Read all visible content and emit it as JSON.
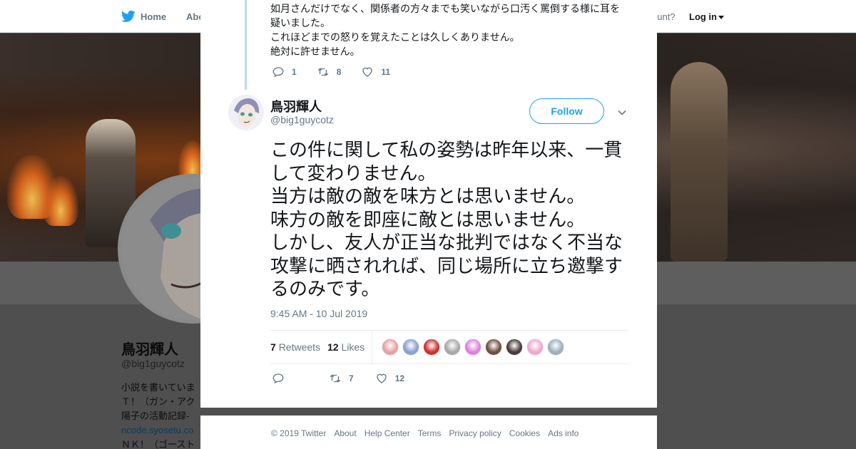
{
  "nav": {
    "home_label": "Home",
    "about_label": "Abo",
    "account_text": "ccount?",
    "login_label": "Log in"
  },
  "profile": {
    "name": "鳥羽輝人",
    "handle": "@big1guycotz",
    "bio_lines": [
      "小説を書いていま",
      "Ｔ！（ガン・アク",
      "陽子の活動記録-",
      "ncode.syosetu.co",
      "ＮＫ！（ゴースト"
    ]
  },
  "previous_tweet": {
    "lines": [
      "如月さんだけでなく、関係者の方々までも笑いながら口汚く罵倒する様に耳を",
      "疑いました。",
      "これほどまでの怒りを覚えたことは久しくありません。",
      "絶対に許せません。"
    ],
    "replies": "1",
    "retweets": "8",
    "likes": "11"
  },
  "tweet": {
    "author_name": "鳥羽輝人",
    "author_handle": "@big1guycotz",
    "follow_label": "Follow",
    "body": "この件に関して私の姿勢は昨年以来、一貫して変わりません。\n当方は敵の敵を味方とは思いません。\n味方の敵を即座に敵とは思いません。\nしかし、友人が正当な批判ではなく不当な攻撃に晒されれば、同じ場所に立ち邀撃するのみです。",
    "timestamp": "9:45 AM - 10 Jul 2019",
    "retweets_count": "7",
    "retweets_label": "Retweets",
    "likes_count": "12",
    "likes_label": "Likes",
    "action_retweets": "7",
    "action_likes": "12"
  },
  "likers": [
    {
      "name": "liker-1",
      "color": "#e8a0a0"
    },
    {
      "name": "liker-2",
      "color": "#8aa0d0"
    },
    {
      "name": "liker-3",
      "color": "#d03030"
    },
    {
      "name": "liker-4",
      "color": "#a8a8a8"
    },
    {
      "name": "liker-5",
      "color": "#e080e0"
    },
    {
      "name": "liker-6",
      "color": "#705040"
    },
    {
      "name": "liker-7",
      "color": "#4a3a3a"
    },
    {
      "name": "liker-8",
      "color": "#f0a8d0"
    },
    {
      "name": "liker-9",
      "color": "#9ab0c0"
    }
  ],
  "footer": {
    "copyright": "© 2019 Twitter",
    "links": [
      "About",
      "Help Center",
      "Terms",
      "Privacy policy",
      "Cookies",
      "Ads info"
    ]
  },
  "colors": {
    "brand_blue": "#1da1f2",
    "thread_line": "#b8dcf2",
    "muted_text": "#657786"
  }
}
